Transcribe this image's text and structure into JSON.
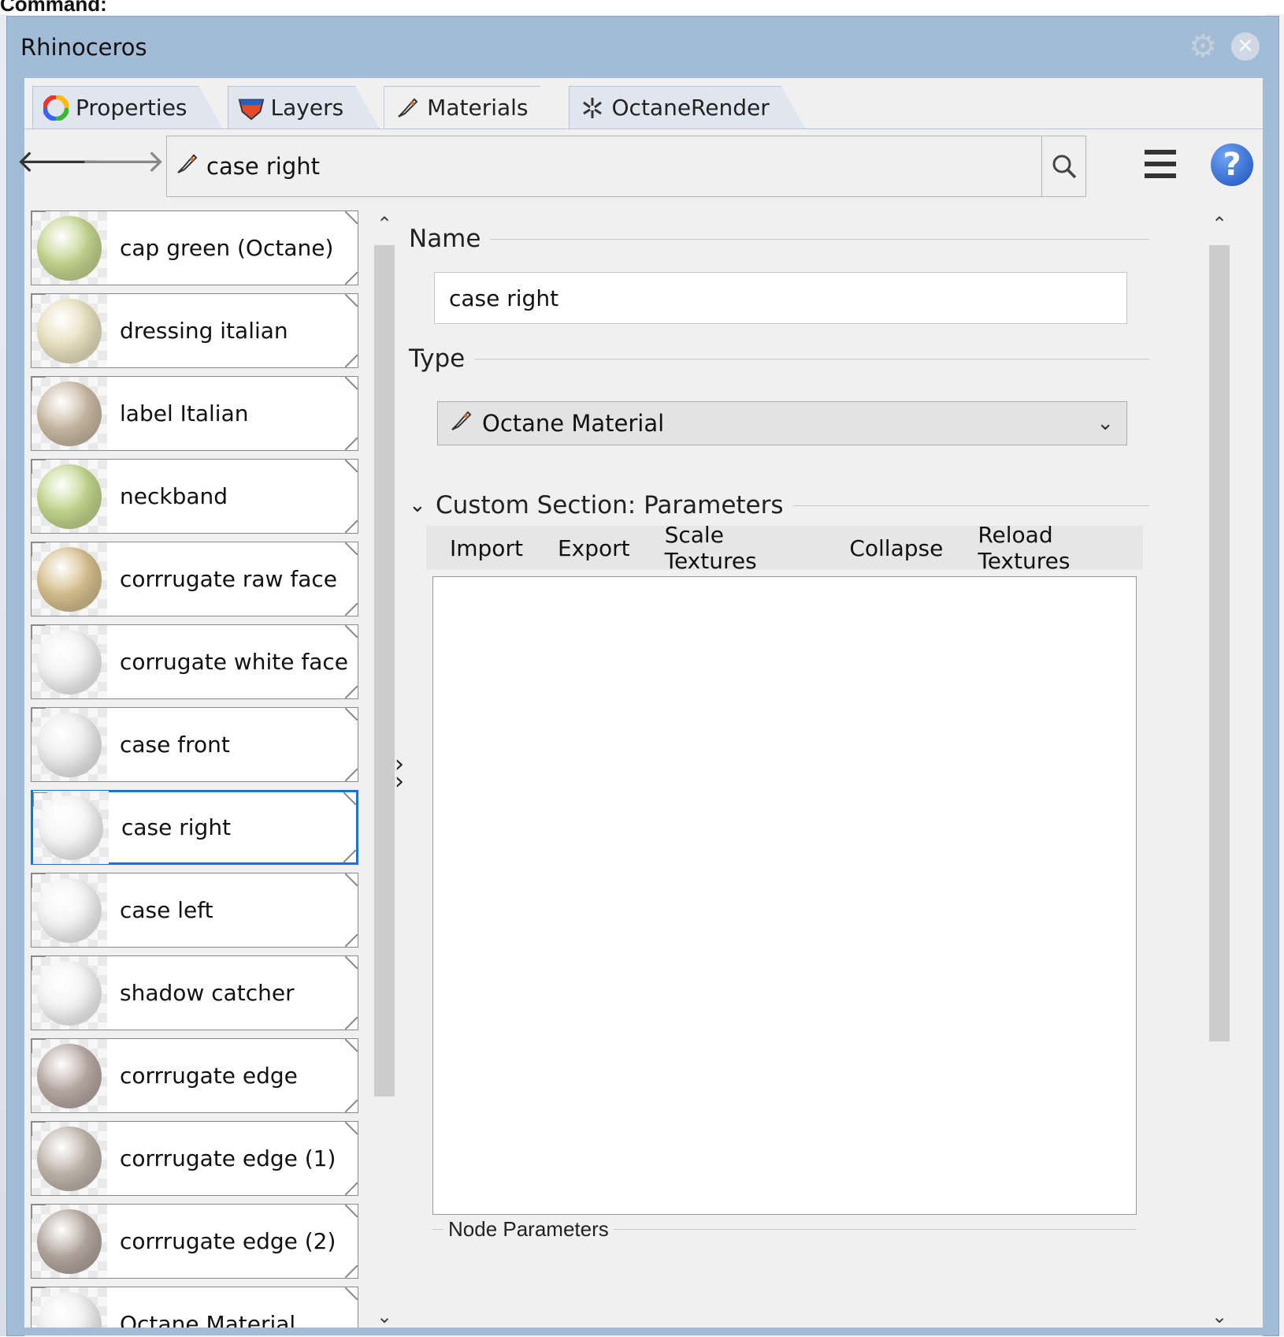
{
  "command_label": "Command:",
  "window": {
    "title": "Rhinoceros"
  },
  "tabs": [
    {
      "label": "Properties",
      "icon": "color-wheel-icon"
    },
    {
      "label": "Layers",
      "icon": "layers-icon"
    },
    {
      "label": "Materials",
      "icon": "materials-brush-icon"
    },
    {
      "label": "OctaneRender",
      "icon": "octane-icon"
    }
  ],
  "toolbar": {
    "current_material": "case right"
  },
  "materials": [
    {
      "label": "cap green (Octane)",
      "color": "#c5d48f"
    },
    {
      "label": "dressing italian",
      "color": "#e8e0bf"
    },
    {
      "label": "label Italian",
      "color": "#c9b9a3"
    },
    {
      "label": "neckband",
      "color": "#c3d58c"
    },
    {
      "label": "corrrugate raw face",
      "color": "#d6bf8e"
    },
    {
      "label": "corrugate white face",
      "color": "#f2f2f2"
    },
    {
      "label": "case front",
      "color": "#ececec"
    },
    {
      "label": "case right",
      "color": "#f5f5f5"
    },
    {
      "label": "case left",
      "color": "#f3f3f3"
    },
    {
      "label": "shadow catcher",
      "color": "#f4f4f4"
    },
    {
      "label": "corrrugate edge",
      "color": "#b8a9a3"
    },
    {
      "label": "corrrugate edge (1)",
      "color": "#bfb5ab"
    },
    {
      "label": "corrrugate edge (2)",
      "color": "#b3a79e"
    },
    {
      "label": "Octane Material",
      "color": "#f0f0f0"
    }
  ],
  "selected_material": "case right",
  "panel": {
    "name_legend": "Name",
    "name_value": "case right",
    "type_legend": "Type",
    "type_value": "Octane Material",
    "section_title": "Custom Section: Parameters",
    "buttons": [
      "Import",
      "Export",
      "Scale Textures",
      "Collapse",
      "Reload Textures"
    ],
    "node_parameters_label": "Node Parameters"
  },
  "colors": {
    "selection": "#1e70c8",
    "window_frame": "#a3bcd6",
    "help": "#1a4fc0"
  }
}
